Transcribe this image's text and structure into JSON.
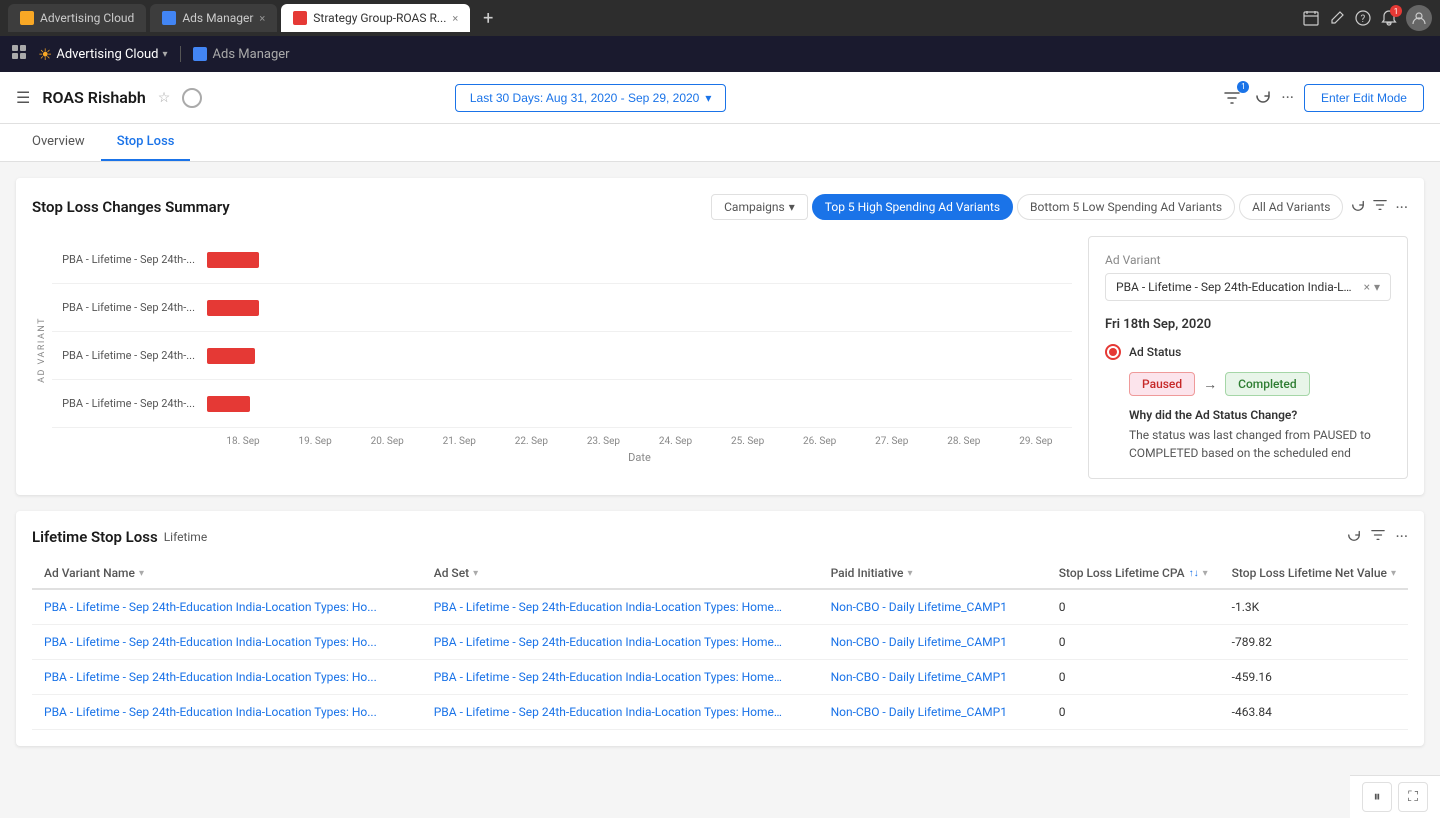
{
  "browser": {
    "tabs": [
      {
        "id": "advertising-cloud",
        "label": "Advertising Cloud",
        "icon_color": "#f9a825",
        "active": false
      },
      {
        "id": "ads-manager",
        "label": "Ads Manager",
        "icon_color": "#4285f4",
        "active": false,
        "closable": true
      },
      {
        "id": "strategy-group",
        "label": "Strategy Group-ROAS R...",
        "icon_color": "#e53935",
        "active": true,
        "closable": true
      }
    ],
    "tab_add_label": "+",
    "icons": {
      "calendar": "📅",
      "edit": "✏️",
      "bell": "🔔",
      "user": "👤"
    },
    "notification_count": "1"
  },
  "app_bar": {
    "logo_text": "Advertising Cloud",
    "divider": true,
    "tab_label": "Ads Manager"
  },
  "page_header": {
    "title": "ROAS Rishabh",
    "date_range": "Last 30 Days: Aug 31, 2020 - Sep 29, 2020",
    "enter_edit_label": "Enter Edit Mode",
    "filter_badge": "1"
  },
  "nav_tabs": [
    {
      "id": "overview",
      "label": "Overview",
      "active": false
    },
    {
      "id": "stop-loss",
      "label": "Stop Loss",
      "active": true
    }
  ],
  "stop_loss_section": {
    "title": "Stop Loss Changes Summary",
    "filter_campaigns_label": "Campaigns",
    "filter_pills": [
      {
        "id": "top5",
        "label": "Top 5 High Spending Ad Variants",
        "active": true
      },
      {
        "id": "bottom5",
        "label": "Bottom 5 Low Spending Ad Variants",
        "active": false
      },
      {
        "id": "all",
        "label": "All Ad Variants",
        "active": false
      }
    ],
    "chart": {
      "y_axis_label": "AD VARIANT",
      "x_axis_label": "Date",
      "x_ticks": [
        "18. Sep",
        "19. Sep",
        "20. Sep",
        "21. Sep",
        "22. Sep",
        "23. Sep",
        "24. Sep",
        "25. Sep",
        "26. Sep",
        "27. Sep",
        "28. Sep",
        "29. Sep"
      ],
      "rows": [
        {
          "label": "PBA - Lifetime - Sep 24th-...",
          "bar_width_pct": 6
        },
        {
          "label": "PBA - Lifetime - Sep 24th-...",
          "bar_width_pct": 6
        },
        {
          "label": "PBA - Lifetime - Sep 24th-...",
          "bar_width_pct": 5.5
        },
        {
          "label": "PBA - Lifetime - Sep 24th-...",
          "bar_width_pct": 5
        }
      ]
    },
    "right_panel": {
      "ad_variant_label": "Ad Variant",
      "ad_variant_value": "PBA - Lifetime - Sep 24th-Education India-Loca...",
      "date_label": "Fri 18th Sep, 2020",
      "ad_status_label": "Ad Status",
      "from_status": "Paused",
      "arrow": "→",
      "to_status": "Completed",
      "change_reason_label": "Why did the Ad Status Change?",
      "change_desc": "The status was last changed from PAUSED to COMPLETED based on the scheduled end"
    }
  },
  "lifetime_stop_loss": {
    "title": "Lifetime Stop Loss",
    "subtitle": "Lifetime",
    "columns": [
      {
        "id": "ad-variant-name",
        "label": "Ad Variant Name",
        "sortable": true
      },
      {
        "id": "ad-set",
        "label": "Ad Set",
        "sortable": true
      },
      {
        "id": "paid-initiative",
        "label": "Paid Initiative",
        "sortable": true
      },
      {
        "id": "stop-loss-cpa",
        "label": "Stop Loss Lifetime CPA",
        "sortable": true,
        "sort_active": true
      },
      {
        "id": "stop-loss-net-value",
        "label": "Stop Loss Lifetime Net Value",
        "sortable": true
      }
    ],
    "rows": [
      {
        "ad_variant": "PBA - Lifetime - Sep 24th-Education India-Location Types: Ho...",
        "ad_set": "PBA - Lifetime - Sep 24th-Education India-Location Types: Home,...",
        "paid_initiative": "Non-CBO - Daily Lifetime_CAMP1",
        "cpa": "0",
        "net_value": "-1.3K"
      },
      {
        "ad_variant": "PBA - Lifetime - Sep 24th-Education India-Location Types: Ho...",
        "ad_set": "PBA - Lifetime - Sep 24th-Education India-Location Types: Home,...",
        "paid_initiative": "Non-CBO - Daily Lifetime_CAMP1",
        "cpa": "0",
        "net_value": "-789.82"
      },
      {
        "ad_variant": "PBA - Lifetime - Sep 24th-Education India-Location Types: Ho...",
        "ad_set": "PBA - Lifetime - Sep 24th-Education India-Location Types: Home,...",
        "paid_initiative": "Non-CBO - Daily Lifetime_CAMP1",
        "cpa": "0",
        "net_value": "-459.16"
      },
      {
        "ad_variant": "PBA - Lifetime - Sep 24th-Education India-Location Types: Ho...",
        "ad_set": "PBA - Lifetime - Sep 24th-Education India-Location Types: Home,...",
        "paid_initiative": "Non-CBO - Daily Lifetime_CAMP1",
        "cpa": "0",
        "net_value": "-463.84"
      }
    ]
  },
  "bottom_toolbar": {
    "pause_icon": "⏸",
    "expand_icon": "⛶"
  }
}
